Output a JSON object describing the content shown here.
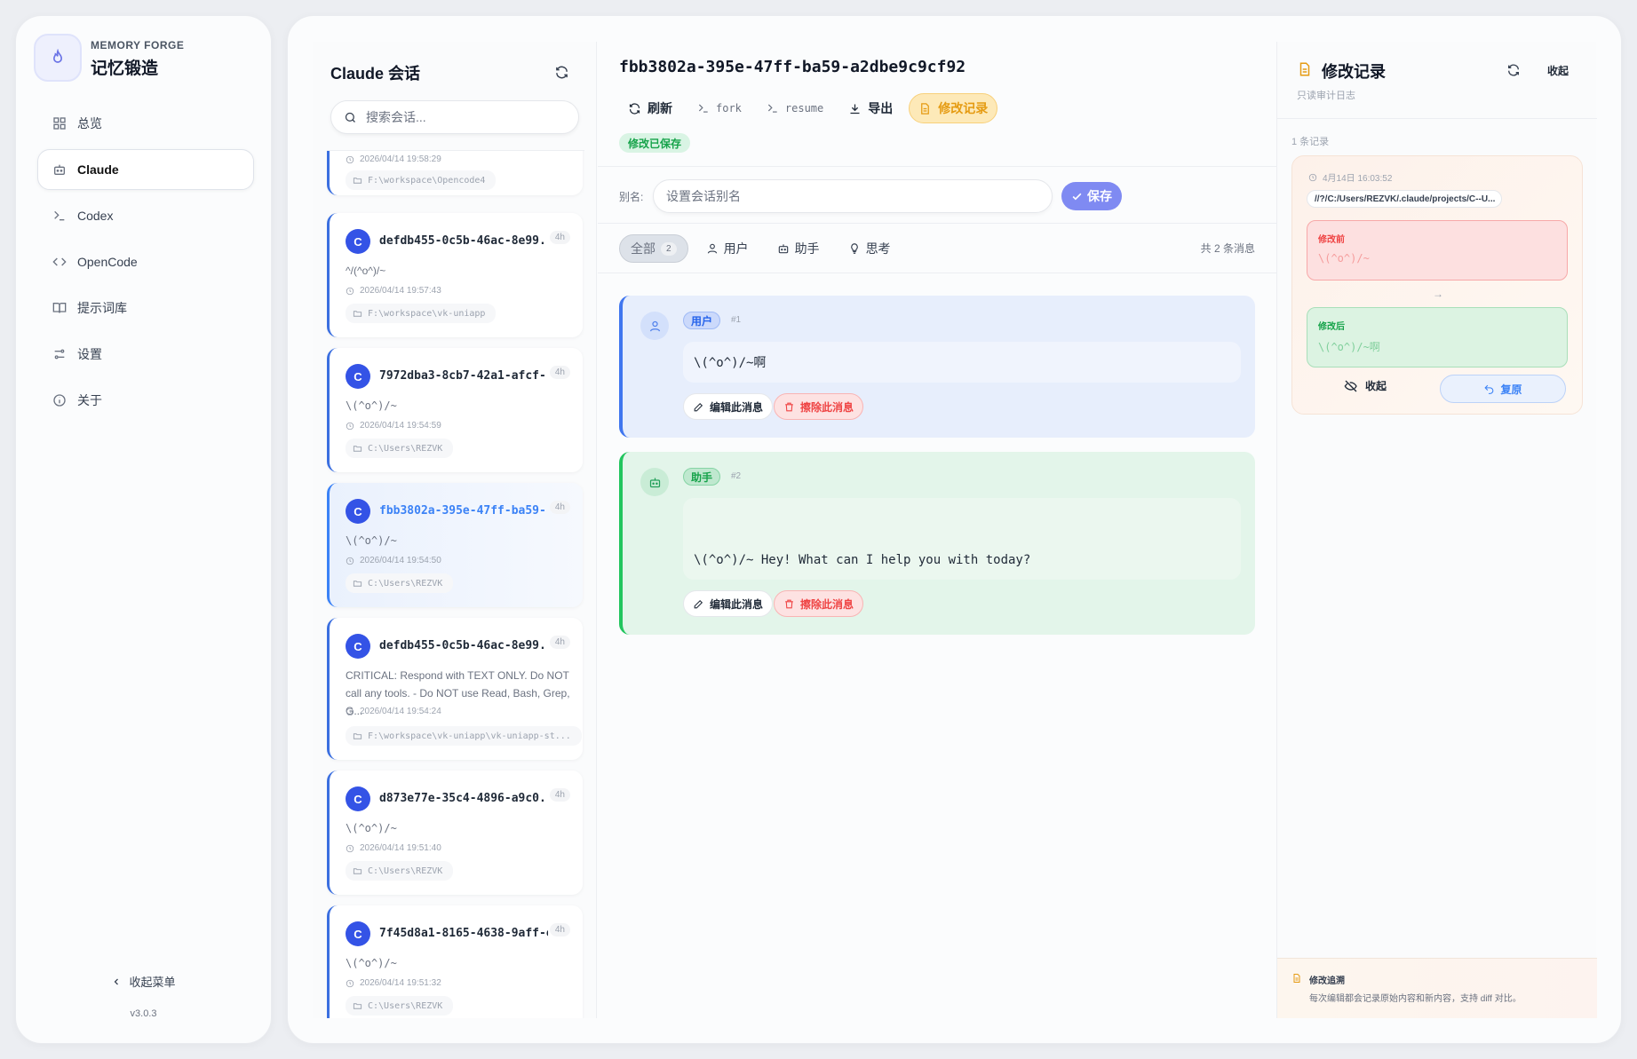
{
  "brand": {
    "en": "MEMORY FORGE",
    "zh": "记忆锻造"
  },
  "nav": [
    {
      "label": "总览",
      "icon": "grid-icon"
    },
    {
      "label": "Claude",
      "icon": "bot-icon",
      "active": true
    },
    {
      "label": "Codex",
      "icon": "terminal-icon"
    },
    {
      "label": "OpenCode",
      "icon": "code-icon"
    },
    {
      "label": "提示词库",
      "icon": "book-icon"
    },
    {
      "label": "设置",
      "icon": "sliders-icon"
    },
    {
      "label": "关于",
      "icon": "info-icon"
    }
  ],
  "sidebar_footer": {
    "collapse": "收起菜单",
    "version": "v3.0.3"
  },
  "sessions": {
    "title": "Claude 会话",
    "search_placeholder": "搜索会话...",
    "items": [
      {
        "id": "",
        "preview": "",
        "time": "2026/04/14 19:58:29",
        "path": "F:\\workspace\\Opencode4",
        "age": ""
      },
      {
        "id": "defdb455-0c5b-46ac-8e99...",
        "preview": "^/(^o^)/~",
        "time": "2026/04/14 19:57:43",
        "path": "F:\\workspace\\vk-uniapp",
        "age": "4h"
      },
      {
        "id": "7972dba3-8cb7-42a1-afcf-...",
        "preview": "\\(^o^)/~",
        "time": "2026/04/14 19:54:59",
        "path": "C:\\Users\\REZVK",
        "age": "4h"
      },
      {
        "id": "fbb3802a-395e-47ff-ba59-...",
        "preview": "\\(^o^)/~",
        "time": "2026/04/14 19:54:50",
        "path": "C:\\Users\\REZVK",
        "age": "4h",
        "selected": true
      },
      {
        "id": "defdb455-0c5b-46ac-8e99...",
        "preview": "CRITICAL: Respond with TEXT ONLY. Do NOT call any tools. - Do NOT use Read, Bash, Grep, G...",
        "time": "2026/04/14 19:54:24",
        "path": "F:\\workspace\\vk-uniapp\\vk-uniapp-st...",
        "age": "4h"
      },
      {
        "id": "d873e77e-35c4-4896-a9c0...",
        "preview": "\\(^o^)/~",
        "time": "2026/04/14 19:51:40",
        "path": "C:\\Users\\REZVK",
        "age": "4h"
      },
      {
        "id": "7f45d8a1-8165-4638-9aff-e...",
        "preview": "\\(^o^)/~",
        "time": "2026/04/14 19:51:32",
        "path": "C:\\Users\\REZVK",
        "age": "4h"
      }
    ]
  },
  "conversation": {
    "id": "fbb3802a-395e-47ff-ba59-a2dbe9c9cf92",
    "toolbar": {
      "refresh": "刷新",
      "fork": "fork",
      "resume": "resume",
      "export": "导出",
      "history": "修改记录"
    },
    "saved_badge": "修改已保存",
    "alias_label": "别名:",
    "alias_placeholder": "设置会话别名",
    "save": "保存",
    "filters": {
      "all": "全部",
      "all_count": "2",
      "user": "用户",
      "assistant": "助手",
      "thinking": "思考"
    },
    "total": "共 2 条消息",
    "messages": [
      {
        "role": "用户",
        "num": "#1",
        "text": "\\(^o^)/~啊"
      },
      {
        "role": "助手",
        "num": "#2",
        "text": "\\(^o^)/~ Hey! What can I help you with today?"
      }
    ],
    "edit": "编辑此消息",
    "delete": "擦除此消息"
  },
  "history": {
    "title": "修改记录",
    "subtitle": "只读审计日志",
    "collapse": "收起",
    "count": "1 条记录",
    "record": {
      "time": "4月14日 16:03:52",
      "path": "//?/C:/Users/REZVK/.claude/projects/C--U...",
      "before_label": "修改前",
      "before": "\\(^o^)/~",
      "after_label": "修改后",
      "after": "\\(^o^)/~啊",
      "fold": "收起",
      "restore": "复原"
    },
    "footer_title": "修改追溯",
    "footer_desc": "每次编辑都会记录原始内容和新内容，支持 diff 对比。"
  }
}
